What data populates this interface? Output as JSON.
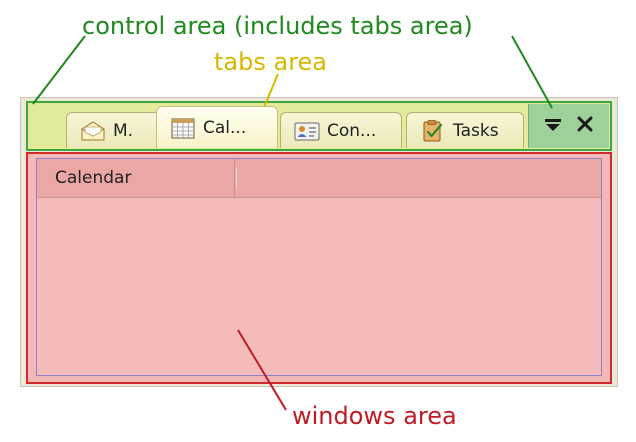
{
  "annotations": {
    "control_area": "control area (includes tabs area)",
    "tabs_area": "tabs area",
    "windows_area": "windows area"
  },
  "tabs": [
    {
      "label": "M.",
      "icon": "mail-icon"
    },
    {
      "label": "Cal...",
      "icon": "calendar-icon",
      "active": true
    },
    {
      "label": "Con...",
      "icon": "contact-card-icon"
    },
    {
      "label": "Tasks",
      "icon": "tasks-icon"
    }
  ],
  "controls": [
    {
      "icon": "menu-dropdown-icon"
    },
    {
      "icon": "close-icon"
    }
  ],
  "window": {
    "column_header": "Calendar"
  },
  "colors": {
    "control_area_border": "#3ea83e",
    "tabs_area_label": "#d6b800",
    "windows_area_border": "#d12a2a",
    "windows_area_fill": "#f4b8b8",
    "control_area_fill": "#e3ea9c",
    "controls_fill": "#9ed09a"
  }
}
